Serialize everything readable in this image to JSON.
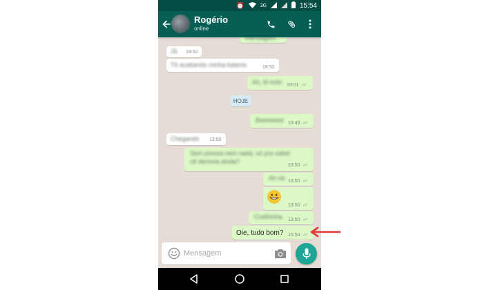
{
  "status_bar": {
    "network": "3G",
    "time": "15:54"
  },
  "toolbar": {
    "contact_name": "Rogério",
    "contact_status": "online",
    "icons": [
      "back-arrow-icon",
      "phone-icon",
      "paperclip-icon",
      "more-vert-icon"
    ]
  },
  "chat": {
    "day_separator": "HOJE",
    "messages": [
      {
        "dir": "out",
        "time": "",
        "content": "blurred"
      },
      {
        "dir": "in",
        "time": "18:52",
        "content": "blurred"
      },
      {
        "dir": "in",
        "time": "18:52",
        "content": "blurred"
      },
      {
        "dir": "out",
        "time": "19:01",
        "content": "blurred"
      },
      {
        "dir": "out",
        "time": "13:49",
        "content": "blurred"
      },
      {
        "dir": "in",
        "time": "13:50",
        "content": "blurred"
      },
      {
        "dir": "out",
        "time": "13:50",
        "content": "blurred"
      },
      {
        "dir": "out",
        "time": "13:50",
        "content": "blurred"
      },
      {
        "dir": "out",
        "time": "13:50",
        "content": "emoji",
        "emoji": "😁"
      },
      {
        "dir": "out",
        "time": "13:50",
        "content": "blurred"
      },
      {
        "dir": "out",
        "time": "15:54",
        "text": "Oie, tudo bom?"
      }
    ]
  },
  "input": {
    "placeholder": "Mensagem"
  },
  "colors": {
    "header": "#075e54",
    "status_bar": "#054d44",
    "chat_bg": "#e5ddd5",
    "outgoing_bubble": "#dcf8c6",
    "incoming_bubble": "#ffffff",
    "mic_button": "#1fa595",
    "annotation_arrow": "#e53935"
  }
}
